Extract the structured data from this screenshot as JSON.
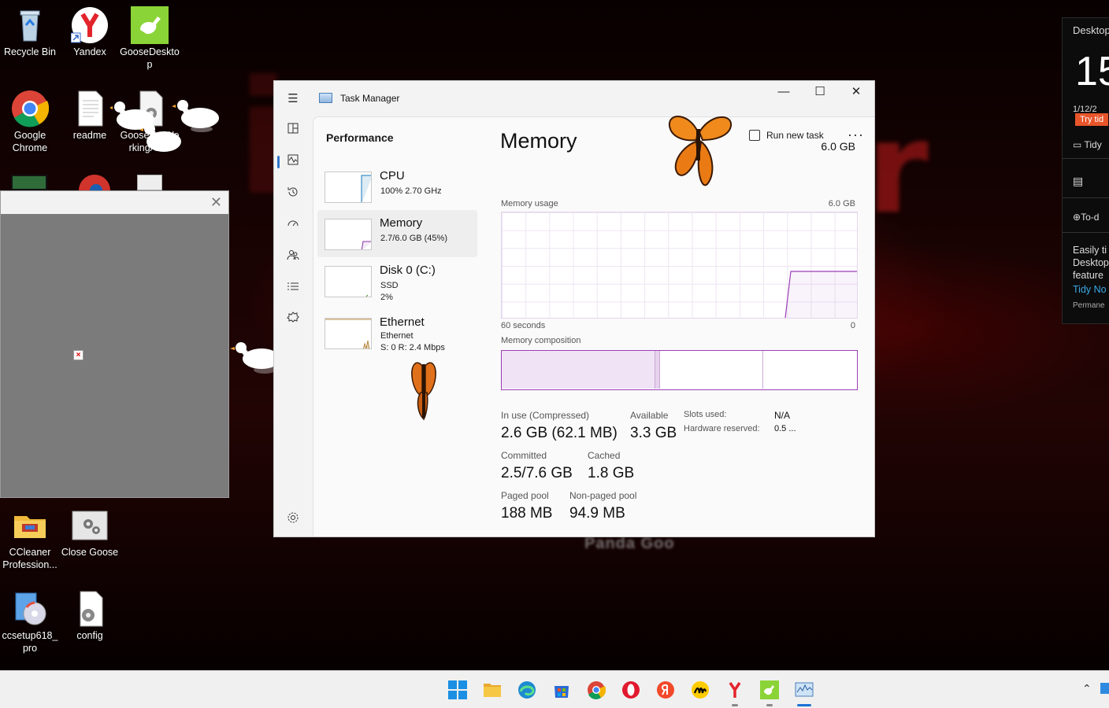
{
  "desktop": {
    "icons": [
      {
        "label": "Recycle Bin"
      },
      {
        "label": "Yandex"
      },
      {
        "label": "GooseDesktop"
      },
      {
        "label": "Google Chrome"
      },
      {
        "label": "readme"
      },
      {
        "label": "GooseNotWorkingAlert"
      },
      {
        "label": "CCleaner Profession..."
      },
      {
        "label": "Close Goose"
      },
      {
        "label": "ccsetup618_pro"
      },
      {
        "label": "config"
      }
    ],
    "wallpaper_text": "ior",
    "wallpaper_sub": "Panda Goo"
  },
  "task_manager": {
    "title": "Task Manager",
    "window_controls": {
      "minimize": "—",
      "maximize": "☐",
      "close": "✕"
    },
    "page_title": "Performance",
    "run_new_task": "Run new task",
    "more": "···",
    "perf_list": [
      {
        "name": "CPU",
        "line1": "100%  2.70 GHz",
        "line2": "",
        "line3": ""
      },
      {
        "name": "Memory",
        "line1": "2.7/6.0 GB (45%)",
        "line2": "",
        "line3": ""
      },
      {
        "name": "Disk 0 (C:)",
        "line1": "SSD",
        "line2": "2%",
        "line3": ""
      },
      {
        "name": "Ethernet",
        "line1": "Ethernet",
        "line2": "S: 0  R: 2.4 Mbps",
        "line3": ""
      }
    ],
    "selected_item": "Memory",
    "memory": {
      "title": "Memory",
      "total": "6.0 GB",
      "usage_label": "Memory usage",
      "usage_max": "6.0 GB",
      "time_left": "60 seconds",
      "time_right": "0",
      "composition_label": "Memory composition",
      "stats": {
        "in_use_label": "In use (Compressed)",
        "in_use_value": "2.6 GB (62.1 MB)",
        "available_label": "Available",
        "available_value": "3.3 GB",
        "committed_label": "Committed",
        "committed_value": "2.5/7.6 GB",
        "cached_label": "Cached",
        "cached_value": "1.8 GB",
        "paged_label": "Paged pool",
        "paged_value": "188 MB",
        "nonpaged_label": "Non-paged pool",
        "nonpaged_value": "94.9 MB",
        "slots_label": "Slots used:",
        "slots_value": "N/A",
        "hw_reserved_label": "Hardware reserved:",
        "hw_reserved_value": "0.5 ..."
      }
    }
  },
  "widget": {
    "title": "Desktop",
    "big_number": "15",
    "date": "1/12/2",
    "try_button": "Try tid",
    "tidy_label": "Tidy",
    "todo_label": "To-d",
    "desc_line1": "Easily ti",
    "desc_line2": "Desktop",
    "desc_line3": "feature",
    "link": "Tidy No",
    "permanent": "Permane"
  },
  "colors": {
    "accent_purple": "#9c3fb6",
    "selection_blue": "#3377cc",
    "try_button_bg": "#e8552a"
  }
}
